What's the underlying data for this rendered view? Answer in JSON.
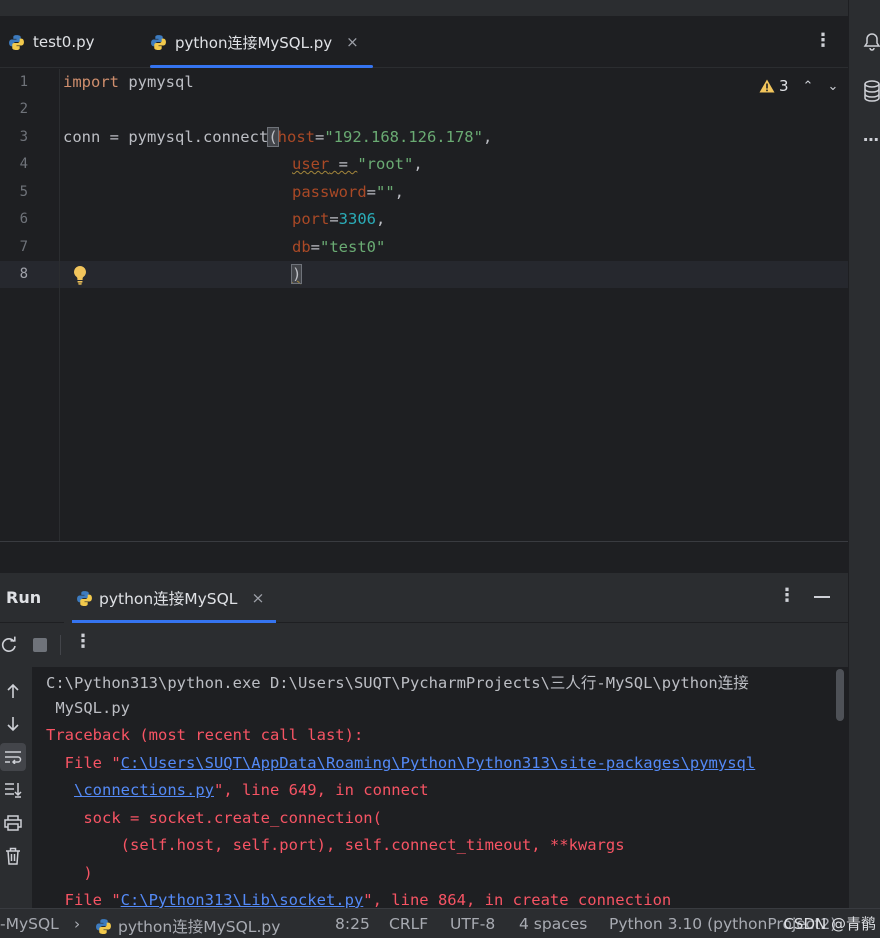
{
  "tabs": [
    {
      "label": "test0.py",
      "icon": "python-file-icon",
      "active": false
    },
    {
      "label": "python连接MySQL.py",
      "icon": "python-file-icon",
      "active": true,
      "close": "×"
    }
  ],
  "tab_menu": "⋮",
  "editor": {
    "line_numbers": [
      "1",
      "2",
      "3",
      "4",
      "5",
      "6",
      "7",
      "8"
    ],
    "current_line": "8",
    "warnings": {
      "count": "3",
      "up": "⌃",
      "down": "⌄"
    },
    "code": {
      "l1_kw": "import",
      "l1_rest": " pymysql",
      "l3_a": "conn = pymysql.connect",
      "l3_paren": "(",
      "l3_param": "host",
      "l3_eq": "=",
      "l3_str": "\"192.168.126.178\"",
      "l3_comma": ",",
      "l4_param": "user",
      "l4_eq": " = ",
      "l4_str": "\"root\"",
      "l4_comma": ",",
      "l5_param": "password",
      "l5_eq": "=",
      "l5_str": "\"\"",
      "l5_comma": ",",
      "l6_param": "port",
      "l6_eq": "=",
      "l6_num": "3306",
      "l6_comma": ",",
      "l7_param": "db",
      "l7_eq": "=",
      "l7_str": "\"test0\"",
      "l8_paren": ")"
    }
  },
  "run": {
    "title": "Run",
    "tab_label": "python连接MySQL",
    "tab_close": "×",
    "menu": "⋮",
    "toolbar_menu": "⋮",
    "console": {
      "cmd1": "C:\\Python313\\python.exe D:\\Users\\SUQT\\PycharmProjects\\三人行-MySQL\\python连接",
      "cmd2": " MySQL.py",
      "tb": "Traceback (most recent call last):",
      "f1_pre": "  File \"",
      "f1_link1": "C:\\Users\\SUQT\\AppData\\Roaming\\Python\\Python313\\site-packages\\pymysql",
      "f1_link2": "\\connections.py",
      "f1_post": "\", line 649, in connect",
      "f1_indent": "   ",
      "code1": "    sock = socket.create_connection(",
      "code2": "        (self.host, self.port), self.connect_timeout, **kwargs",
      "code3": "    )",
      "f2_pre": "  File \"",
      "f2_link": "C:\\Python313\\Lib\\socket.py",
      "f2_post": "\", line 864, in create_connection"
    }
  },
  "status": {
    "project": "-MySQL",
    "sep": "›",
    "file": "python连接MySQL.py",
    "position": "8:25",
    "line_sep": "CRLF",
    "encoding": "UTF-8",
    "indent": "4 spaces",
    "interpreter": "Python 3.10 (pythonProject2)",
    "watermark": "CSDN @青鹡"
  },
  "colors": {
    "accent": "#3574f0",
    "error": "#f75464",
    "link": "#548af7",
    "string": "#6aab73",
    "keyword": "#cf8e6d"
  }
}
